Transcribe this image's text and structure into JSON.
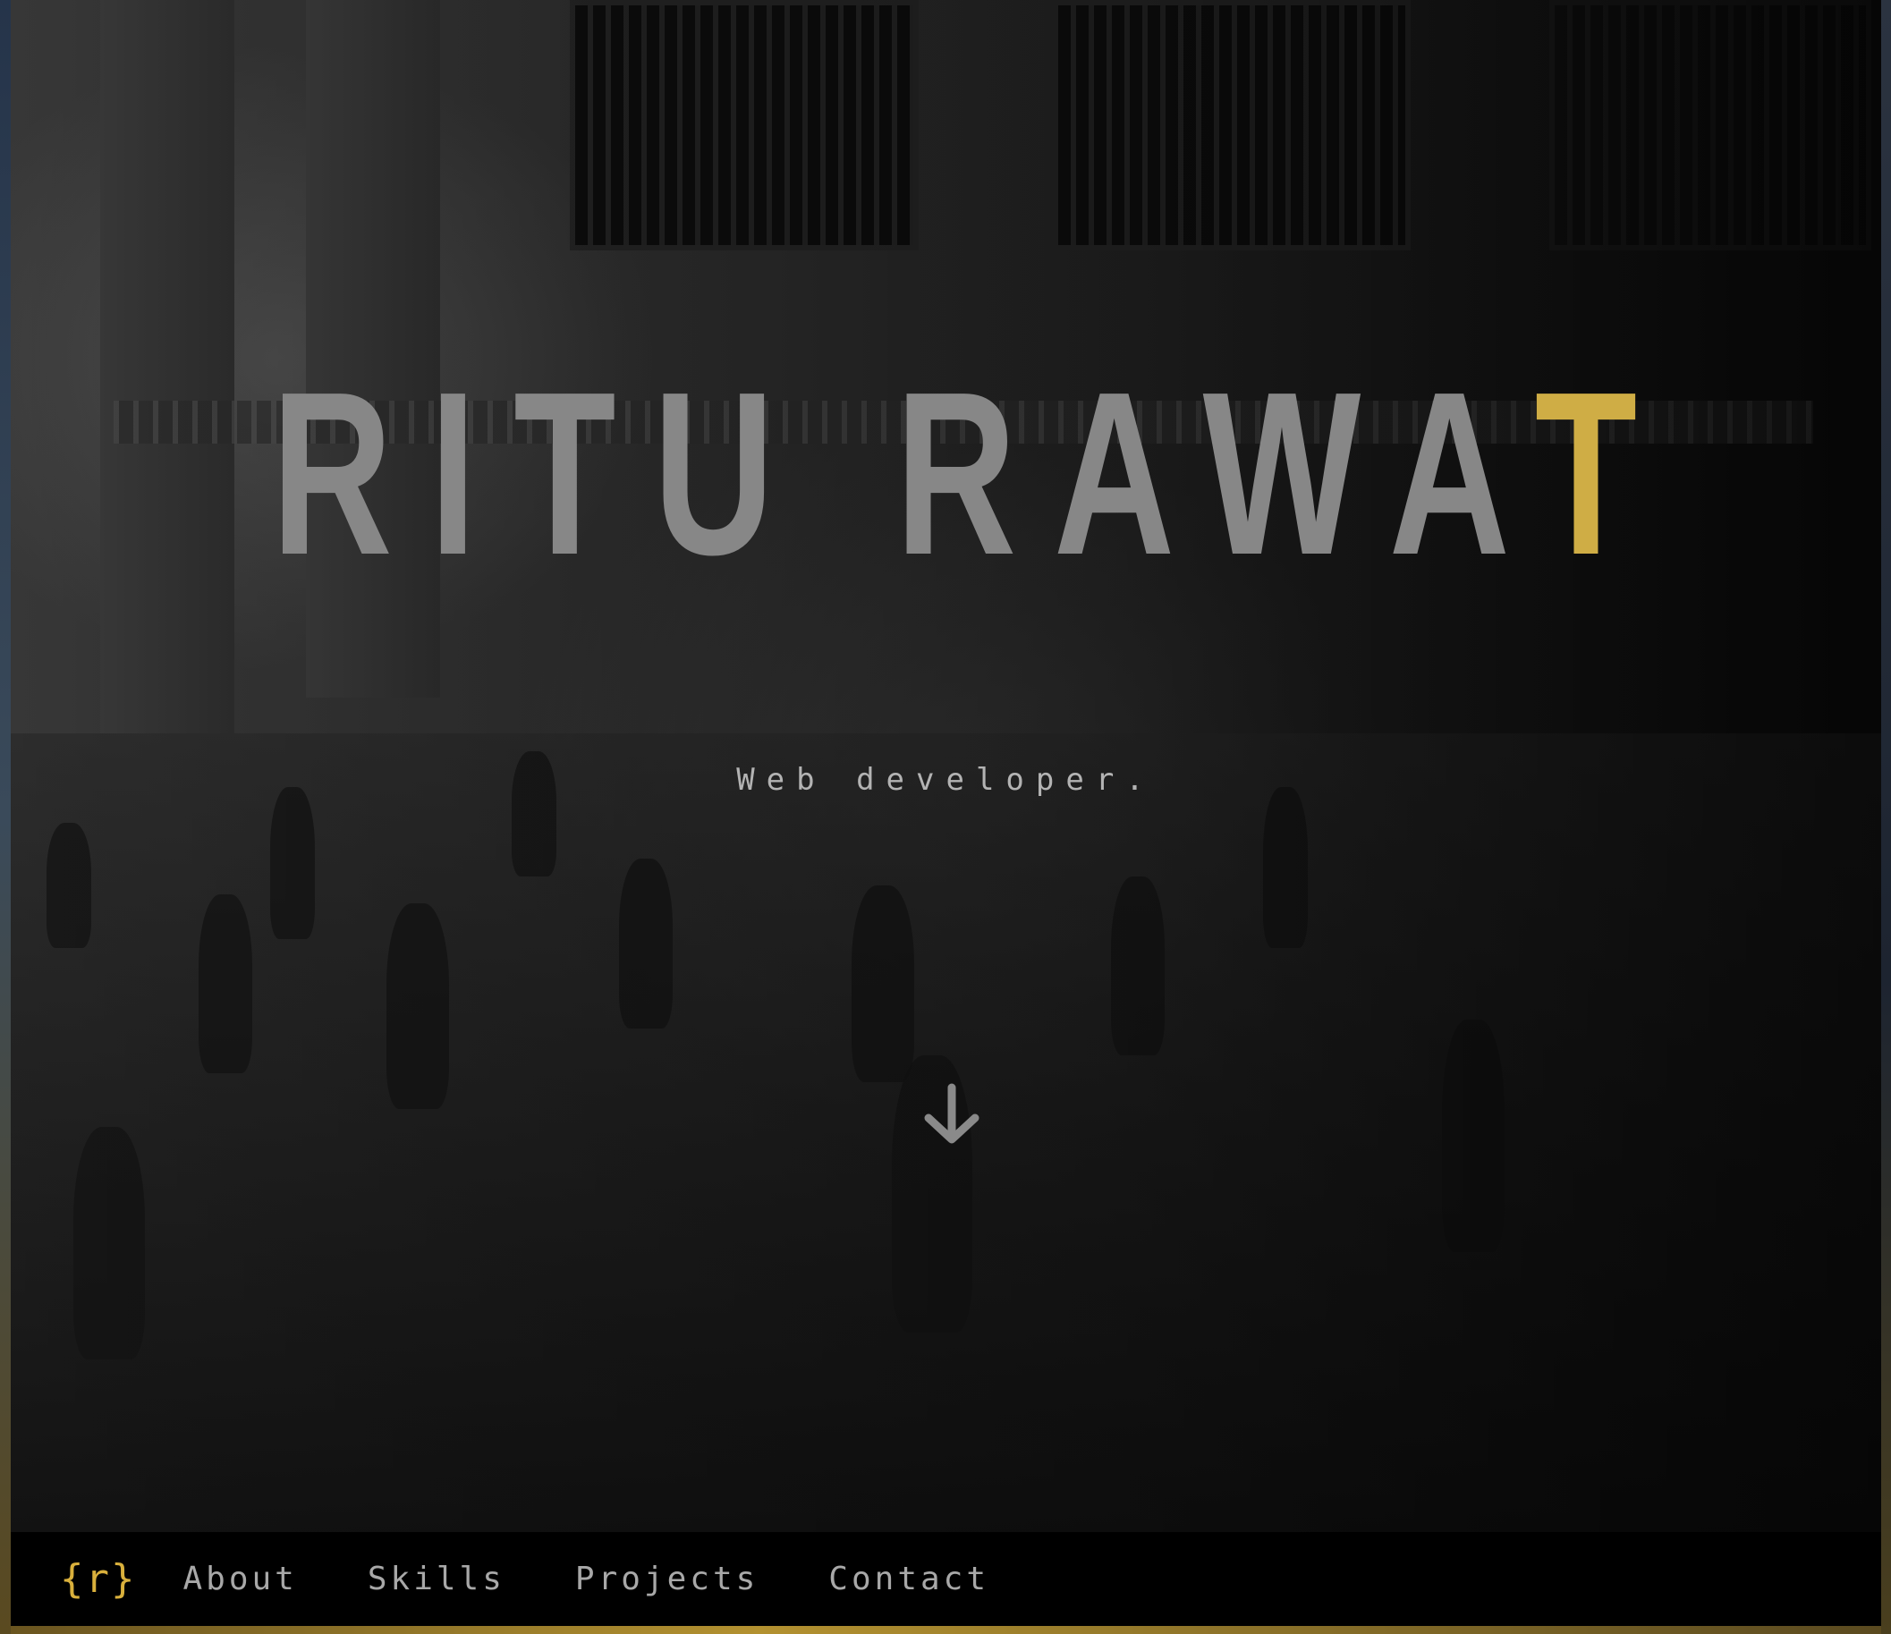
{
  "hero": {
    "title_main": "RITU RAWA",
    "title_accent": "T",
    "subtitle": "Web developer.",
    "scroll_icon": "arrow-down-icon"
  },
  "navbar": {
    "logo": "{r}",
    "items": [
      {
        "label": "About"
      },
      {
        "label": "Skills"
      },
      {
        "label": "Projects"
      },
      {
        "label": "Contact"
      }
    ]
  },
  "colors": {
    "accent": "#cfad45",
    "title": "#878787",
    "subtitle": "#b3b3b3",
    "nav_text": "#a8a8a8",
    "nav_bg": "#000000"
  }
}
